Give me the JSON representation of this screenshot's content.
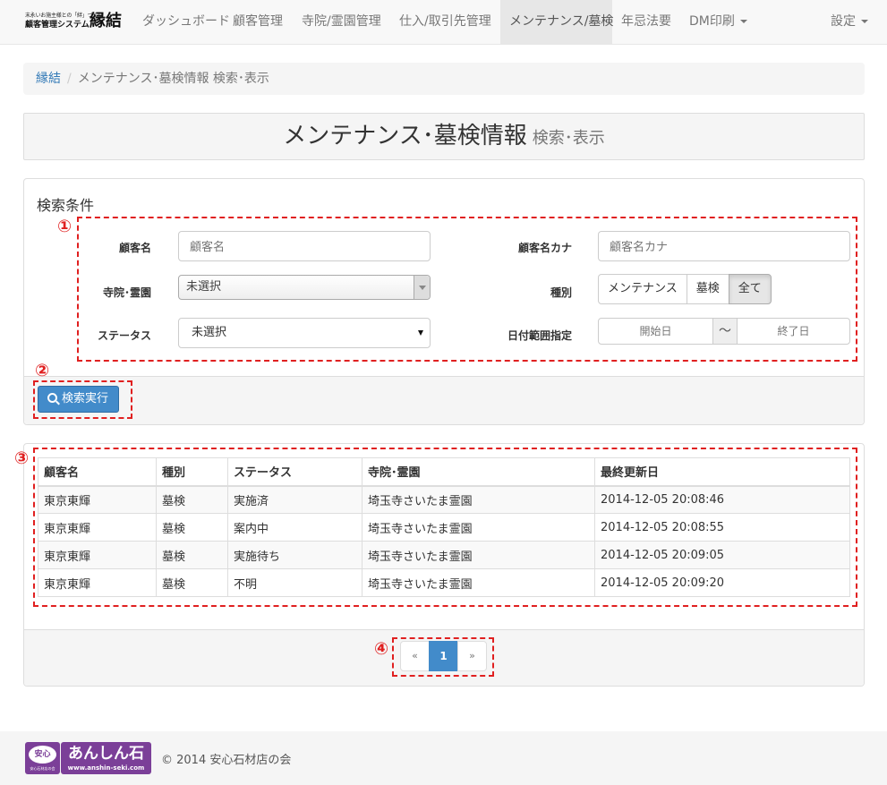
{
  "navbar": {
    "brand": {
      "tagline": "末永いお施主様との「絆」づくり",
      "system": "顧客管理システム",
      "name": "縁結"
    },
    "items": [
      {
        "label": "ダッシュボード"
      },
      {
        "label": "顧客管理"
      },
      {
        "label": "寺院/霊園管理"
      },
      {
        "label": "仕入/取引先管理"
      },
      {
        "label": "メンテナンス/墓検"
      },
      {
        "label": "年忌法要"
      },
      {
        "label": "DM印刷"
      }
    ],
    "settings": "設定"
  },
  "breadcrumb": {
    "home": "縁結",
    "separator": "/",
    "current": "メンテナンス･墓検情報 検索･表示"
  },
  "page_header": {
    "title": "メンテナンス･墓検情報",
    "subtitle": "検索･表示"
  },
  "search": {
    "title": "検索条件",
    "customer_name_label": "顧客名",
    "customer_name_placeholder": "顧客名",
    "customer_kana_label": "顧客名カナ",
    "customer_kana_placeholder": "顧客名カナ",
    "temple_label": "寺院･霊園",
    "temple_value": "未選択",
    "type_label": "種別",
    "type_options": [
      "メンテナンス",
      "墓検",
      "全て"
    ],
    "status_label": "ステータス",
    "status_value": "未選択",
    "date_label": "日付範囲指定",
    "date_start_placeholder": "開始日",
    "date_separator": "〜",
    "date_end_placeholder": "終了日",
    "submit_label": "検索実行"
  },
  "annotations": {
    "marker_1": "①",
    "marker_2": "②",
    "marker_3": "③",
    "marker_4": "④",
    "color": "#e02020"
  },
  "results": {
    "columns": [
      "顧客名",
      "種別",
      "ステータス",
      "寺院･霊園",
      "最終更新日"
    ],
    "rows": [
      [
        "東京東輝",
        "墓検",
        "実施済",
        "埼玉寺さいたま霊園",
        "2014-12-05 20:08:46"
      ],
      [
        "東京東輝",
        "墓検",
        "案内中",
        "埼玉寺さいたま霊園",
        "2014-12-05 20:08:55"
      ],
      [
        "東京東輝",
        "墓検",
        "実施待ち",
        "埼玉寺さいたま霊園",
        "2014-12-05 20:09:05"
      ],
      [
        "東京東輝",
        "墓検",
        "不明",
        "埼玉寺さいたま霊園",
        "2014-12-05 20:09:20"
      ]
    ]
  },
  "pagination": {
    "prev": "«",
    "current": "1",
    "next": "»"
  },
  "footer": {
    "logo": {
      "seal": "安心",
      "seal_caption": "安心石材店の会",
      "name": "あんしん石",
      "url": "www.anshin-seki.com"
    },
    "copyright": "© 2014 安心石材店の会"
  },
  "colors": {
    "primary": "#428bca",
    "link": "#337ab7",
    "brand_purple": "#7b3f98",
    "annotation_red": "#e02020"
  }
}
